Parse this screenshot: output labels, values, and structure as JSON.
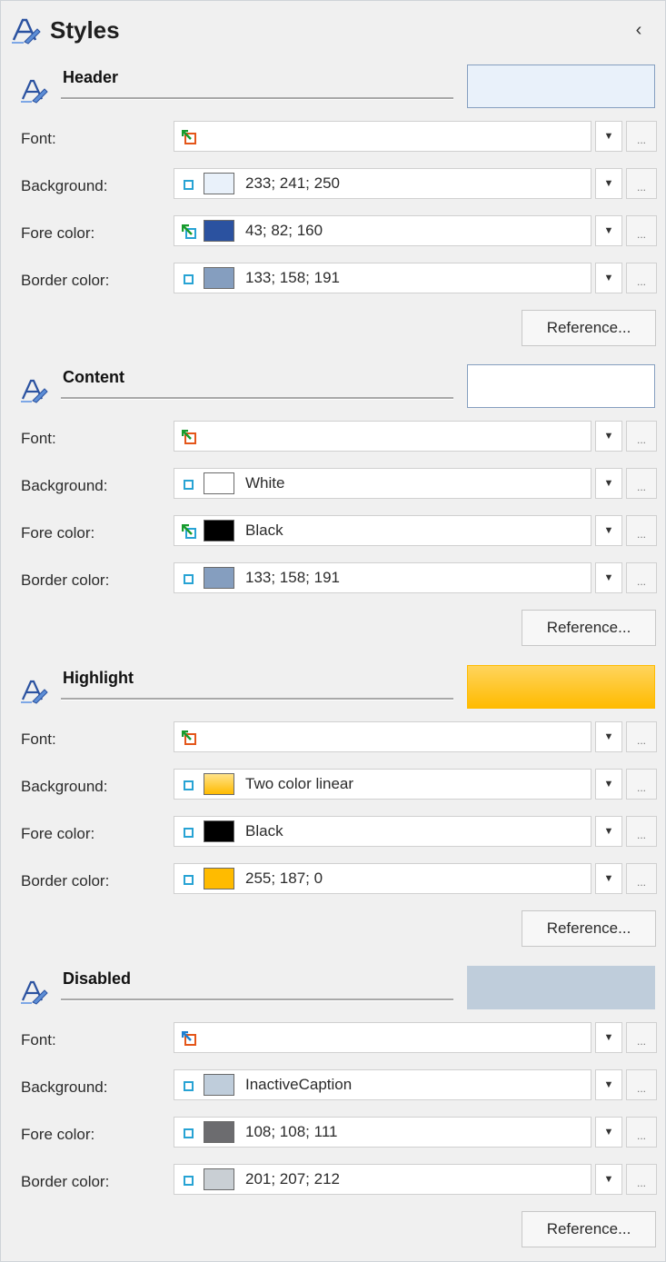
{
  "panel": {
    "title": "Styles",
    "collapse_glyph": "‹"
  },
  "labels": {
    "font": "Font:",
    "background": "Background:",
    "fore_color": "Fore color:",
    "border_color": "Border color:",
    "arrow": "▼",
    "ellipsis": "...",
    "reference": "Reference..."
  },
  "sections": [
    {
      "title": "Header",
      "preview": {
        "background": "#e9f1fa",
        "border": "#859ebf"
      },
      "font_inherit": "green-orange",
      "background": {
        "inherit": "blue",
        "swatch": "#e9f1fa",
        "value": "233; 241; 250"
      },
      "fore_color": {
        "inherit": "green",
        "swatch": "#2b52a0",
        "value": "43; 82; 160"
      },
      "border_color": {
        "inherit": "blue",
        "swatch": "#859ebf",
        "value": "133; 158; 191"
      }
    },
    {
      "title": "Content",
      "preview": {
        "background": "#ffffff",
        "border": "#859ebf"
      },
      "font_inherit": "green-orange",
      "background": {
        "inherit": "blue",
        "swatch": "#ffffff",
        "value": "White"
      },
      "fore_color": {
        "inherit": "green",
        "swatch": "#000000",
        "value": "Black"
      },
      "border_color": {
        "inherit": "blue",
        "swatch": "#859ebf",
        "value": "133; 158; 191"
      }
    },
    {
      "title": "Highlight",
      "preview": {
        "background": "linear-gradient(#ffd45c,#ffbb00)",
        "border": "#ffbb00"
      },
      "font_inherit": "green-orange",
      "background": {
        "inherit": "blue",
        "swatch": "linear-gradient(#ffe38a,#ffbb00)",
        "value": "Two color linear"
      },
      "fore_color": {
        "inherit": "blue",
        "swatch": "#000000",
        "value": "Black"
      },
      "border_color": {
        "inherit": "blue",
        "swatch": "#ffbb00",
        "value": "255; 187; 0"
      }
    },
    {
      "title": "Disabled",
      "preview": {
        "background": "#bfcddb",
        "border": "#bfcddb"
      },
      "font_inherit": "blue-orange",
      "background": {
        "inherit": "blue",
        "swatch": "#bfcddb",
        "value": "InactiveCaption"
      },
      "fore_color": {
        "inherit": "blue",
        "swatch": "#6c6c6f",
        "value": "108; 108; 111"
      },
      "border_color": {
        "inherit": "blue",
        "swatch": "#c9cfd4",
        "value": "201; 207; 212"
      }
    }
  ]
}
